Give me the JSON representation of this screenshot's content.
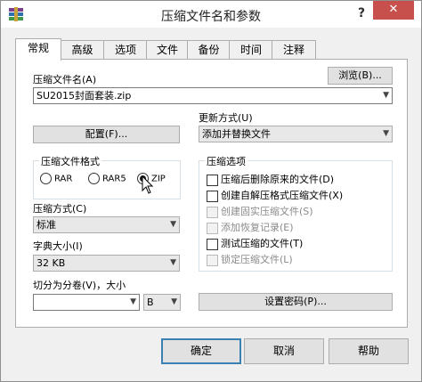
{
  "window": {
    "title": "压缩文件名和参数",
    "help": "?",
    "close": "✕"
  },
  "tabs": [
    "常规",
    "高级",
    "选项",
    "文件",
    "备份",
    "时间",
    "注释"
  ],
  "archive_name": {
    "label": "压缩文件名(A)",
    "value": "SU2015封面套装.zip",
    "browse": "浏览(B)..."
  },
  "update_mode": {
    "label": "更新方式(U)",
    "value": "添加并替换文件"
  },
  "profiles_button": "配置(F)...",
  "format": {
    "title": "压缩文件格式",
    "options": [
      "RAR",
      "RAR5",
      "ZIP"
    ],
    "selected": "ZIP"
  },
  "method": {
    "label": "压缩方式(C)",
    "value": "标准"
  },
  "dict_size": {
    "label": "字典大小(I)",
    "value": "32 KB"
  },
  "split": {
    "label": "切分为分卷(V)，大小",
    "value": "",
    "unit": "B"
  },
  "options": {
    "title": "压缩选项",
    "items": [
      {
        "label": "压缩后删除原来的文件(D)",
        "checked": false,
        "disabled": false
      },
      {
        "label": "创建自解压格式压缩文件(X)",
        "checked": false,
        "disabled": false
      },
      {
        "label": "创建固实压缩文件(S)",
        "checked": false,
        "disabled": true
      },
      {
        "label": "添加恢复记录(E)",
        "checked": false,
        "disabled": true
      },
      {
        "label": "测试压缩的文件(T)",
        "checked": false,
        "disabled": false
      },
      {
        "label": "锁定压缩文件(L)",
        "checked": false,
        "disabled": true
      }
    ]
  },
  "password_button": "设置密码(P)...",
  "buttons": {
    "ok": "确定",
    "cancel": "取消",
    "help": "帮助"
  }
}
